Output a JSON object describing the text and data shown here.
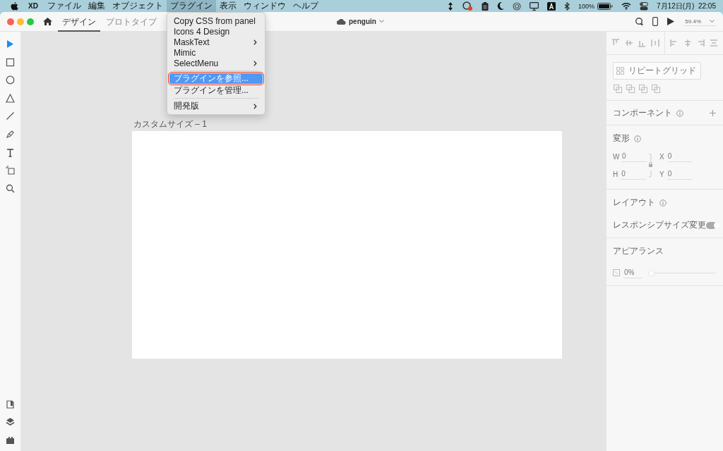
{
  "menubar": {
    "app": "XD",
    "menus": [
      {
        "label": "ファイル",
        "selected": false
      },
      {
        "label": "編集",
        "selected": false
      },
      {
        "label": "オブジェクト",
        "selected": false
      },
      {
        "label": "プラグイン",
        "selected": true
      },
      {
        "label": "表示",
        "selected": false
      },
      {
        "label": "ウィンドウ",
        "selected": false
      },
      {
        "label": "ヘルプ",
        "selected": false
      }
    ],
    "battery": "100%",
    "clock": "7月12日(月)  22:05"
  },
  "window": {
    "tabs": [
      {
        "label": "デザイン",
        "selected": true
      },
      {
        "label": "プロトタイプ",
        "selected": false
      }
    ],
    "document": "penguin",
    "zoom": "59.4%"
  },
  "tools": [
    {
      "kind": "select",
      "selected": true
    },
    {
      "kind": "rectangle",
      "selected": false
    },
    {
      "kind": "ellipse",
      "selected": false
    },
    {
      "kind": "polygon",
      "selected": false
    },
    {
      "kind": "line",
      "selected": false
    },
    {
      "kind": "pen",
      "selected": false
    },
    {
      "kind": "text",
      "selected": false
    },
    {
      "kind": "artboard",
      "selected": false
    },
    {
      "kind": "zoom",
      "selected": false
    }
  ],
  "bottom_tools": [
    {
      "kind": "assets"
    },
    {
      "kind": "layers"
    },
    {
      "kind": "plugins"
    }
  ],
  "plugin_menu": [
    {
      "kind": "item",
      "label": "Copy CSS from panel",
      "submenu": false,
      "selected": false,
      "outlined": false
    },
    {
      "kind": "item",
      "label": "Icons 4 Design",
      "submenu": false,
      "selected": false,
      "outlined": false
    },
    {
      "kind": "item",
      "label": "MaskText",
      "submenu": true,
      "selected": false,
      "outlined": false
    },
    {
      "kind": "item",
      "label": "Mimic",
      "submenu": false,
      "selected": false,
      "outlined": false
    },
    {
      "kind": "item",
      "label": "SelectMenu",
      "submenu": true,
      "selected": false,
      "outlined": false
    },
    {
      "kind": "separator"
    },
    {
      "kind": "item",
      "label": "プラグインを参照...",
      "submenu": false,
      "selected": true,
      "outlined": true
    },
    {
      "kind": "item",
      "label": "プラグインを管理...",
      "submenu": false,
      "selected": false,
      "outlined": false
    },
    {
      "kind": "separator"
    },
    {
      "kind": "item",
      "label": "開発版",
      "submenu": true,
      "selected": false,
      "outlined": false
    }
  ],
  "artboard": {
    "label": "カスタムサイズ – 1"
  },
  "properties": {
    "repeat_grid": "リピートグリッド",
    "component": "コンポーネント",
    "transform": {
      "title": "変形",
      "fields": [
        {
          "label": "W",
          "value": "0"
        },
        {
          "label": "X",
          "value": "0"
        },
        {
          "label": "H",
          "value": "0"
        },
        {
          "label": "Y",
          "value": "0"
        }
      ]
    },
    "layout": {
      "title": "レイアウト",
      "responsive": "レスポンシブサイズ変更",
      "on": true
    },
    "appearance": {
      "title": "アピアランス",
      "opacity": "0%",
      "level": 0
    }
  }
}
